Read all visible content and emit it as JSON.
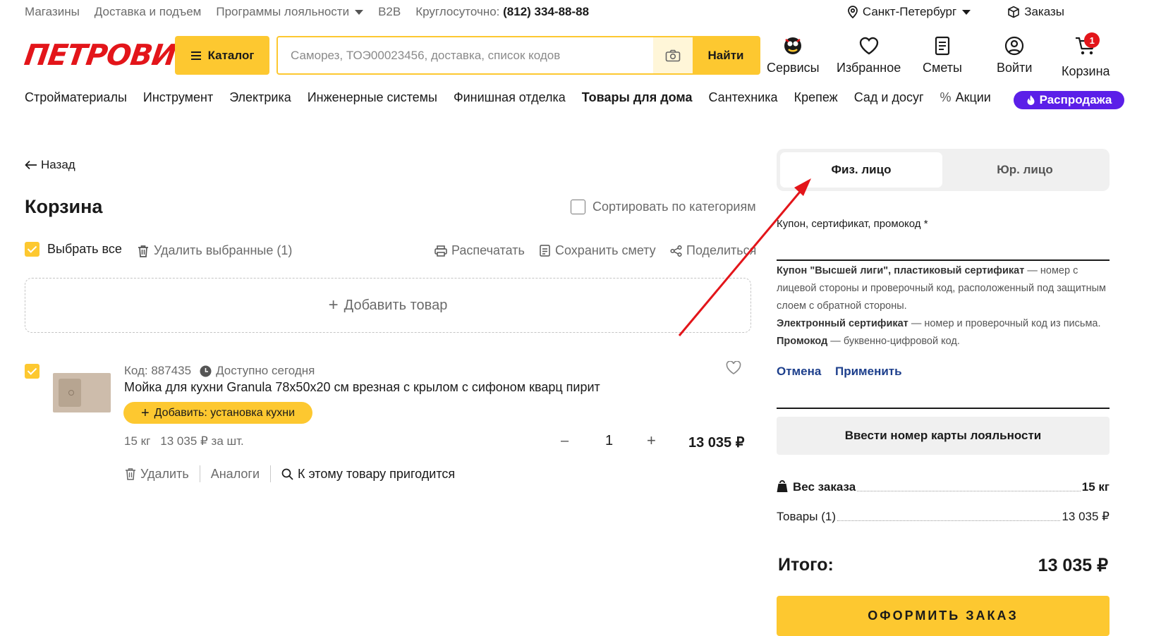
{
  "topbar": {
    "links": [
      "Магазины",
      "Доставка и подъем",
      "Программы лояльности",
      "B2B"
    ],
    "phone_label": "Круглосуточно:",
    "phone": "(812) 334-88-88",
    "city": "Санкт-Петербург",
    "orders": "Заказы"
  },
  "header": {
    "logo": "ПЕТРОВИЧ",
    "catalog": "Каталог",
    "search_placeholder": "Саморез, ТОЭ00023456, доставка, список кодов",
    "search_button": "Найти",
    "icons": {
      "services": "Сервисы",
      "favorites": "Избранное",
      "estimates": "Сметы",
      "login": "Войти",
      "cart": "Корзина",
      "cart_count": "1"
    }
  },
  "nav": {
    "items": [
      "Стройматериалы",
      "Инструмент",
      "Электрика",
      "Инженерные системы",
      "Финишная отделка",
      "Товары для дома",
      "Сантехника",
      "Крепеж",
      "Сад и досуг",
      "Акции"
    ],
    "sale": "Распродажа"
  },
  "cart": {
    "back": "Назад",
    "title": "Корзина",
    "sort_by_category": "Сортировать по категориям",
    "select_all": "Выбрать все",
    "delete_selected": "Удалить выбранные (1)",
    "print": "Распечатать",
    "save_estimate": "Сохранить смету",
    "share": "Поделиться",
    "add_product": "Добавить товар",
    "item": {
      "code": "Код: 887435",
      "availability": "Доступно сегодня",
      "name": "Мойка для кухни Granula 78x50x20 см врезная с крылом с сифоном кварц пирит",
      "addon": "Добавить: установка кухни",
      "weight": "15 кг",
      "unit_price": "13 035 ₽ за шт.",
      "minus": "–",
      "quantity": "1",
      "plus": "+",
      "price": "13 035 ₽",
      "delete": "Удалить",
      "analogs": "Аналоги",
      "related": "К этому товару пригодится"
    }
  },
  "summary": {
    "tab_individual": "Физ. лицо",
    "tab_legal": "Юр. лицо",
    "coupon_label": "Купон, сертификат, промокод *",
    "help1_bold": "Купон \"Высшей лиги\", пластиковый сертификат",
    "help1_text": " — номер с лицевой стороны и проверочный код, расположенный под защитным слоем с обратной стороны.",
    "help2_bold": "Электронный сертификат",
    "help2_text": " — номер и проверочный код из письма.",
    "help3_bold": "Промокод",
    "help3_text": " — буквенно-цифровой код.",
    "cancel": "Отмена",
    "apply": "Применить",
    "loyalty_card": "Ввести номер карты лояльности",
    "weight_label": "Вес заказа",
    "weight_value": "15 кг",
    "goods_label": "Товары (1)",
    "goods_value": "13 035 ₽",
    "total_label": "Итого:",
    "total_value": "13 035 ₽",
    "checkout": "ОФОРМИТЬ ЗАКАЗ"
  },
  "colors": {
    "accent_yellow": "#fdc830",
    "brand_red": "#e3151a",
    "sale_purple": "#5b1fe8",
    "link_blue": "#1d3f8c"
  }
}
